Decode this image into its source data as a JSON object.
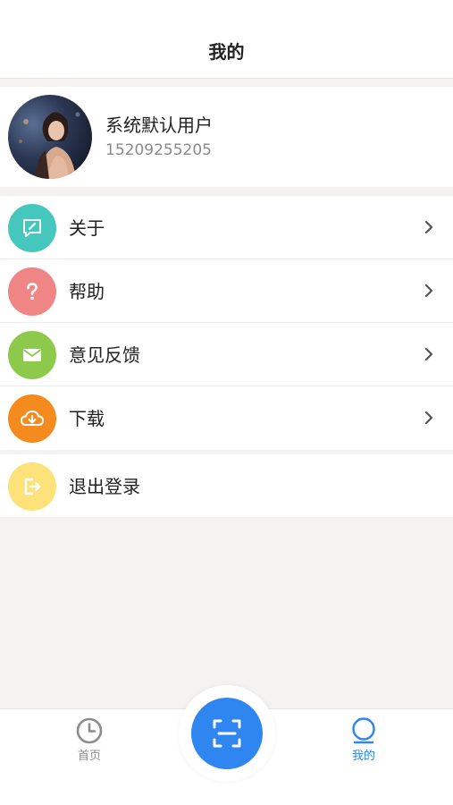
{
  "header": {
    "title": "我的"
  },
  "profile": {
    "name": "系统默认用户",
    "phone": "15209255205"
  },
  "menu": {
    "items": [
      {
        "label": "关于",
        "icon": "message-icon",
        "color": "#46c7bd"
      },
      {
        "label": "帮助",
        "icon": "question-icon",
        "color": "#f08585"
      },
      {
        "label": "意见反馈",
        "icon": "mail-icon",
        "color": "#8dc94a"
      },
      {
        "label": "下载",
        "icon": "cloud-download-icon",
        "color": "#f58a1f"
      }
    ]
  },
  "logout": {
    "label": "退出登录",
    "icon": "logout-icon",
    "color": "#fde27a"
  },
  "tabbar": {
    "home_label": "首页",
    "mine_label": "我的",
    "active_color": "#2f86f1",
    "inactive_color": "#8c8c8c"
  }
}
